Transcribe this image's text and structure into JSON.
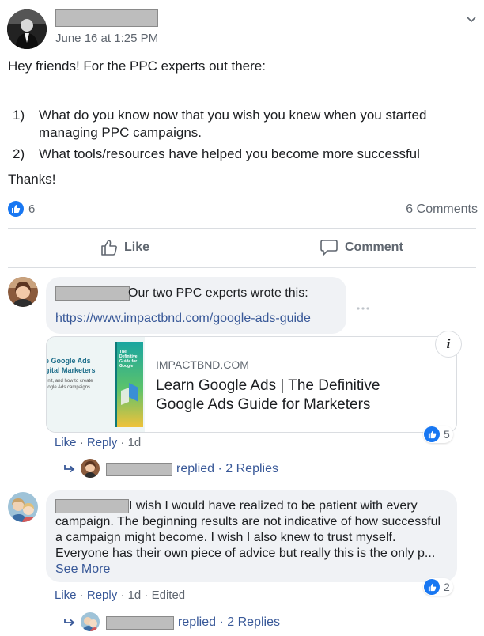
{
  "post": {
    "timestamp": "June 16 at 1:25 PM",
    "text_intro": "Hey friends! For the PPC experts out there:",
    "list": [
      {
        "num": "1)",
        "text": "What do you know now that you wish you knew when you started managing PPC campaigns."
      },
      {
        "num": "2)",
        "text": "What tools/resources have helped you become more successful"
      }
    ],
    "text_outro": "Thanks!",
    "like_count": "6",
    "comments_count": "6 Comments",
    "actions": {
      "like": "Like",
      "comment": "Comment"
    },
    "menu_icon": "chevron-down-icon"
  },
  "comments": [
    {
      "text": "Our two PPC experts wrote this:",
      "url": "https://www.impactbnd.com/google-ads-guide",
      "options_icon": "more-horizontal-icon",
      "link_preview": {
        "domain": "IMPACTBND.COM",
        "title": "Learn Google Ads | The Definitive Google Ads Guide for Marketers",
        "thumb_title_line1": "e Google Ads",
        "thumb_title_line2": "gital Marketers",
        "thumb_sub_line1": "on't, and how to create",
        "thumb_sub_line2": "oogle Ads campaigns",
        "book_title": "The Definitive Guide for Google",
        "info_icon": "i"
      },
      "meta": {
        "like": "Like",
        "reply": "Reply",
        "time": "1d"
      },
      "reaction_count": "5",
      "replies": {
        "text": "replied",
        "count": "2 Replies"
      }
    },
    {
      "text": "I wish I would have realized to be patient with every campaign. The beginning results are not indicative of how successful a campaign might become. I wish I also knew to trust myself. Everyone has their own piece of advice but really this is the only p...",
      "see_more": "See More",
      "meta": {
        "like": "Like",
        "reply": "Reply",
        "time": "1d",
        "edited": "Edited"
      },
      "reaction_count": "2",
      "replies": {
        "text": "replied",
        "count": "2 Replies"
      }
    }
  ],
  "colors": {
    "link": "#385898",
    "like_blue": "#1877f2",
    "bubble": "#f0f2f5",
    "muted": "#606770"
  }
}
